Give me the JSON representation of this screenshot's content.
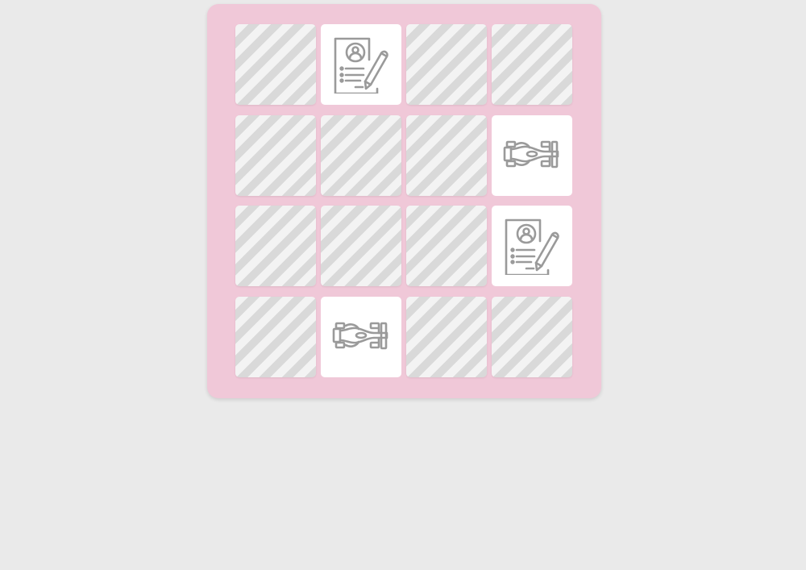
{
  "game": {
    "type": "memory-match",
    "cards": [
      {
        "state": "down"
      },
      {
        "state": "up",
        "icon": "form-icon"
      },
      {
        "state": "down"
      },
      {
        "state": "down"
      },
      {
        "state": "down"
      },
      {
        "state": "down"
      },
      {
        "state": "down"
      },
      {
        "state": "up",
        "icon": "race-car-icon"
      },
      {
        "state": "down"
      },
      {
        "state": "down"
      },
      {
        "state": "down"
      },
      {
        "state": "up",
        "icon": "form-icon"
      },
      {
        "state": "down"
      },
      {
        "state": "up",
        "icon": "race-car-icon"
      },
      {
        "state": "down"
      },
      {
        "state": "down"
      }
    ],
    "colors": {
      "page_background": "#eaeaea",
      "board_background": "#f0c8d8",
      "card_face": "#ffffff",
      "card_back_stripe_dark": "#d9d9d9",
      "card_back_stripe_light": "#f3f3f3",
      "icon_stroke": "#9a9a9a"
    }
  }
}
